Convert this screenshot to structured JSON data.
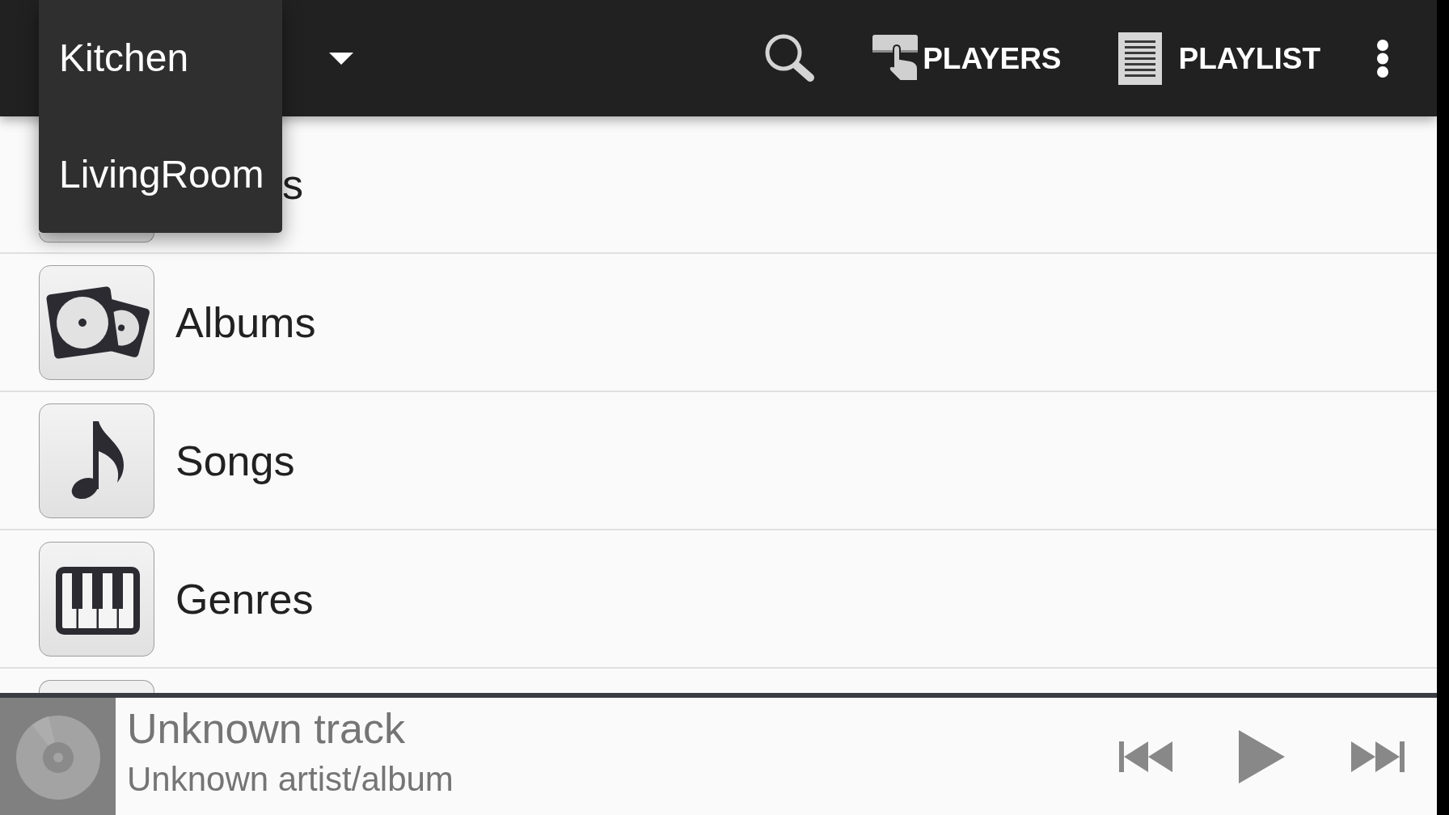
{
  "toolbar": {
    "players_button": "PLAYERS",
    "playlist_button": "PLAYLIST"
  },
  "dropdown_menu": {
    "items": [
      "Kitchen",
      "LivingRoom"
    ]
  },
  "library_list": {
    "items": [
      {
        "kind": "covered",
        "label": "s"
      },
      {
        "kind": "full",
        "label": "Albums"
      },
      {
        "kind": "full",
        "label": "Songs"
      },
      {
        "kind": "full",
        "label": "Genres"
      },
      {
        "kind": "cut"
      }
    ]
  },
  "now_playing": {
    "title": "Unknown track",
    "subtitle": "Unknown artist/album",
    "playing": false
  }
}
